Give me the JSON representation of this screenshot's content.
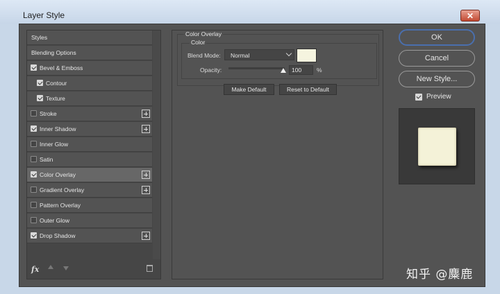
{
  "window": {
    "title": "Layer Style",
    "close_label": "✕"
  },
  "styles_list": [
    {
      "label": "Styles",
      "checkbox": false,
      "checked": false,
      "indent": false,
      "plus": false,
      "active": false
    },
    {
      "label": "Blending Options",
      "checkbox": false,
      "checked": false,
      "indent": false,
      "plus": false,
      "active": false
    },
    {
      "label": "Bevel & Emboss",
      "checkbox": true,
      "checked": true,
      "indent": false,
      "plus": false,
      "active": false
    },
    {
      "label": "Contour",
      "checkbox": true,
      "checked": true,
      "indent": true,
      "plus": false,
      "active": false
    },
    {
      "label": "Texture",
      "checkbox": true,
      "checked": true,
      "indent": true,
      "plus": false,
      "active": false
    },
    {
      "label": "Stroke",
      "checkbox": true,
      "checked": false,
      "indent": false,
      "plus": true,
      "active": false
    },
    {
      "label": "Inner Shadow",
      "checkbox": true,
      "checked": true,
      "indent": false,
      "plus": true,
      "active": false
    },
    {
      "label": "Inner Glow",
      "checkbox": true,
      "checked": false,
      "indent": false,
      "plus": false,
      "active": false
    },
    {
      "label": "Satin",
      "checkbox": true,
      "checked": false,
      "indent": false,
      "plus": false,
      "active": false
    },
    {
      "label": "Color Overlay",
      "checkbox": true,
      "checked": true,
      "indent": false,
      "plus": true,
      "active": true
    },
    {
      "label": "Gradient Overlay",
      "checkbox": true,
      "checked": false,
      "indent": false,
      "plus": true,
      "active": false
    },
    {
      "label": "Pattern Overlay",
      "checkbox": true,
      "checked": false,
      "indent": false,
      "plus": false,
      "active": false
    },
    {
      "label": "Outer Glow",
      "checkbox": true,
      "checked": false,
      "indent": false,
      "plus": false,
      "active": false
    },
    {
      "label": "Drop Shadow",
      "checkbox": true,
      "checked": true,
      "indent": false,
      "plus": true,
      "active": false
    }
  ],
  "bottom_toolbar": {
    "fx_label": "fx"
  },
  "color_overlay": {
    "section_title": "Color Overlay",
    "group_title": "Color",
    "blend_mode_label": "Blend Mode:",
    "blend_mode_value": "Normal",
    "overlay_color": "#f5f4df",
    "opacity_label": "Opacity:",
    "opacity_value": "100",
    "opacity_unit": "%",
    "opacity_percent": 100,
    "make_default_label": "Make Default",
    "reset_default_label": "Reset to Default"
  },
  "actions": {
    "ok_label": "OK",
    "cancel_label": "Cancel",
    "new_style_label": "New Style...",
    "preview_label": "Preview",
    "preview_checked": true
  },
  "watermark": {
    "text": "知乎 @麋鹿"
  }
}
